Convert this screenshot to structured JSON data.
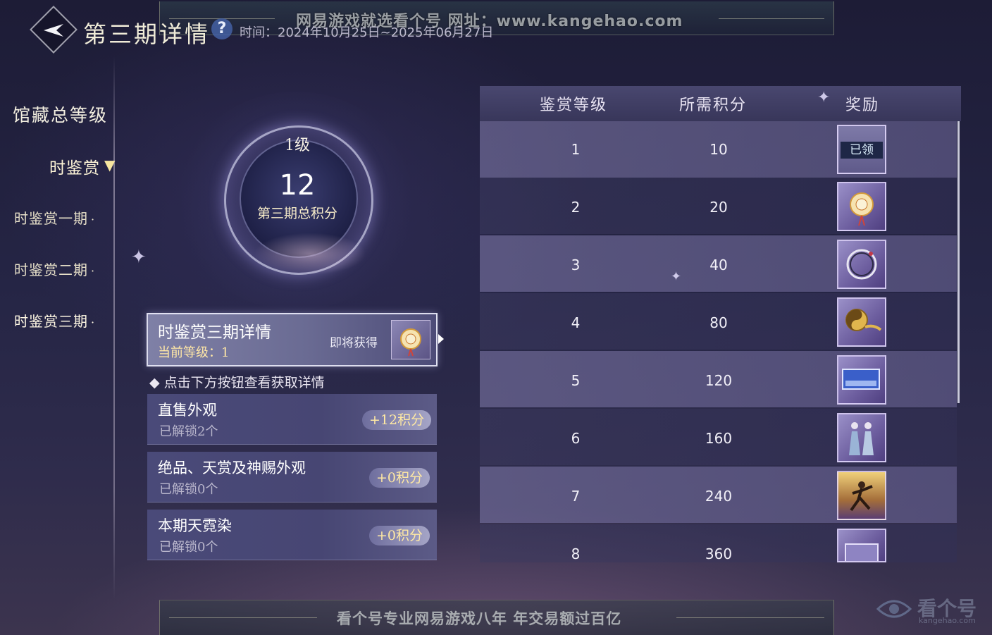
{
  "banner": {
    "top_text": "网易游戏就选看个号   网址：www.kangehao.com",
    "bottom_text": "看个号专业网易游戏八年   年交易额过百亿"
  },
  "header": {
    "title": "第三期详情",
    "help_icon": "question-mark",
    "time_text": "时间：2024年10月25日~2025年06月27日"
  },
  "nav": {
    "main": "馆藏总等级",
    "current": "时鉴赏",
    "items": [
      {
        "label": "时鉴赏一期"
      },
      {
        "label": "时鉴赏二期"
      },
      {
        "label": "时鉴赏三期"
      }
    ]
  },
  "progress": {
    "level_label": "1级",
    "score": "12",
    "score_label": "第三期总积分"
  },
  "detail_card": {
    "title": "时鉴赏三期详情",
    "current_level": "当前等级：1",
    "upcoming_label": "即将获得",
    "upcoming_icon": "pendant-charm-icon"
  },
  "hint": "◆ 点击下方按钮查看获取详情",
  "sources": [
    {
      "name": "直售外观",
      "count": "已解锁2个",
      "points": "+12积分"
    },
    {
      "name": "绝品、天赏及神赐外观",
      "count": "已解锁0个",
      "points": "+0积分"
    },
    {
      "name": "本期天霓染",
      "count": "已解锁0个",
      "points": "+0积分"
    }
  ],
  "table": {
    "headers": [
      "鉴赏等级",
      "所需积分",
      "奖励"
    ],
    "claimed_label": "已领",
    "rows": [
      {
        "level": "1",
        "points": "10",
        "reward": "claimed"
      },
      {
        "level": "2",
        "points": "20",
        "reward": "pendant-charm-icon"
      },
      {
        "level": "3",
        "points": "40",
        "reward": "ring-frame-icon"
      },
      {
        "level": "4",
        "points": "80",
        "reward": "taiji-emblem-icon"
      },
      {
        "level": "5",
        "points": "120",
        "reward": "blue-banner-icon"
      },
      {
        "level": "6",
        "points": "160",
        "reward": "twin-figures-icon"
      },
      {
        "level": "7",
        "points": "240",
        "reward": "martial-pose-icon"
      },
      {
        "level": "8",
        "points": "360",
        "reward": "scroll-frame-icon"
      }
    ]
  },
  "watermark": {
    "name": "看个号",
    "domain": "kangehao.com"
  },
  "colors": {
    "accent_gold": "#ffe7a6",
    "background": "#252545"
  }
}
